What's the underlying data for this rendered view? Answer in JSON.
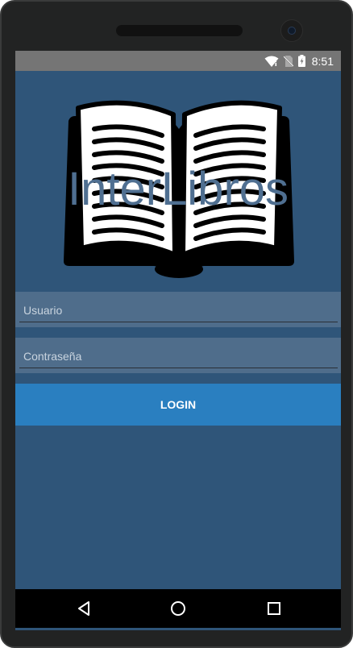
{
  "status_bar": {
    "time": "8:51",
    "icons": [
      "wifi-icon",
      "no-sim-icon",
      "battery-charging-icon"
    ]
  },
  "app": {
    "title": "InterLibros",
    "logo_icon": "open-book-icon"
  },
  "form": {
    "username_placeholder": "Usuario",
    "password_placeholder": "Contraseña",
    "login_label": "LOGIN"
  },
  "nav_bar": {
    "icons": [
      "back-icon",
      "home-icon",
      "recents-icon"
    ]
  },
  "colors": {
    "screen_background": "#2f5579",
    "field_background": "#4f6d8b",
    "login_button": "#2a7fc0",
    "status_bar": "#757575",
    "title_text": "#4f6f91"
  }
}
